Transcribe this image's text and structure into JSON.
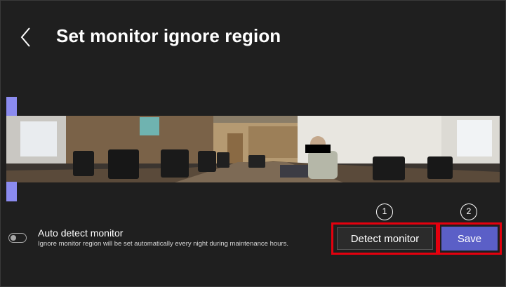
{
  "header": {
    "back_icon": "chevron-left-icon",
    "title": "Set monitor ignore region"
  },
  "auto_detect": {
    "label": "Auto detect monitor",
    "description": "Ignore monitor region will be set automatically every night during maintenance hours.",
    "enabled": false
  },
  "actions": {
    "detect_label": "Detect monitor",
    "save_label": "Save"
  },
  "annotations": {
    "step1": "1",
    "step2": "2"
  },
  "colors": {
    "background": "#1f1f1f",
    "accent": "#5b5fc7",
    "handle": "#8b8bef",
    "highlight": "#e4000e"
  }
}
